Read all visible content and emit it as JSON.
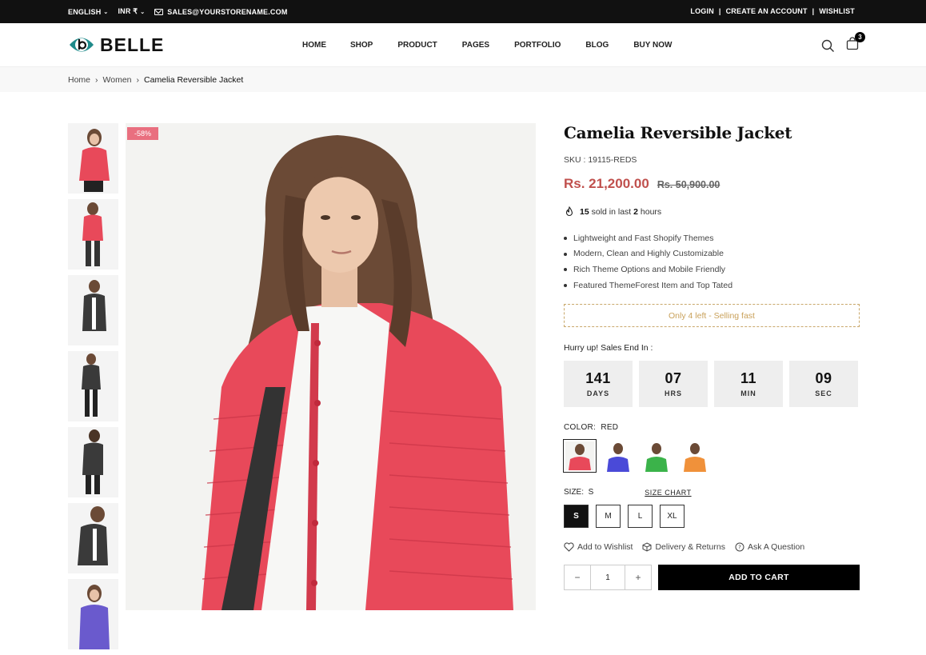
{
  "topbar": {
    "language": "ENGLISH",
    "currency": "INR ₹",
    "email": "SALES@YOURSTORENAME.COM",
    "login": "LOGIN",
    "create_account": "CREATE AN ACCOUNT",
    "wishlist": "WISHLIST",
    "separator": "|"
  },
  "header": {
    "logo_text": "BELLE",
    "nav": [
      "HOME",
      "SHOP",
      "PRODUCT",
      "PAGES",
      "PORTFOLIO",
      "BLOG",
      "BUY NOW"
    ],
    "cart_count": "3"
  },
  "breadcrumb": {
    "home": "Home",
    "category": "Women",
    "current": "Camelia Reversible Jacket",
    "sep": "›"
  },
  "gallery": {
    "discount_badge": "-58%",
    "thumb_colors": [
      "#e8495a",
      "#e8495a",
      "#3a3a3a",
      "#3a3a3a",
      "#3a3a3a",
      "#3a3a3a",
      "#6a5acd"
    ]
  },
  "product": {
    "title": "Camelia Reversible Jacket",
    "sku": "SKU : 19115-REDS",
    "price": "Rs. 21,200.00",
    "old_price": "Rs. 50,900.00",
    "sold_count": "15",
    "sold_mid": "sold in last",
    "sold_hours": "2",
    "sold_end": "hours",
    "features": [
      "Lightweight and Fast Shopify Themes",
      "Modern, Clean and Highly Customizable",
      "Rich Theme Options and Mobile Friendly",
      "Featured ThemeForest Item and Top Tated"
    ],
    "stock_text": "Only 4 left - Selling fast",
    "hurry_text": "Hurry up! Sales End In :",
    "countdown": [
      {
        "value": "141",
        "label": "DAYS"
      },
      {
        "value": "07",
        "label": "HRS"
      },
      {
        "value": "11",
        "label": "MIN"
      },
      {
        "value": "09",
        "label": "SEC"
      }
    ],
    "color_label": "COLOR:",
    "color_value": "RED",
    "swatch_colors": [
      "#e8495a",
      "#4a4ad8",
      "#3bb34a",
      "#f0913a"
    ],
    "size_label": "SIZE:",
    "size_value": "S",
    "size_chart": "SIZE CHART",
    "sizes": [
      "S",
      "M",
      "L",
      "XL"
    ],
    "links": {
      "wishlist": "Add to Wishlist",
      "delivery": "Delivery & Returns",
      "question": "Ask A Question"
    },
    "qty_minus": "−",
    "qty_plus": "+",
    "quantity": "1",
    "add_to_cart": "ADD TO CART"
  },
  "colors": {
    "accent_price": "#c0504d",
    "badge": "#e96f7f",
    "stock_text": "#c9a15a"
  }
}
